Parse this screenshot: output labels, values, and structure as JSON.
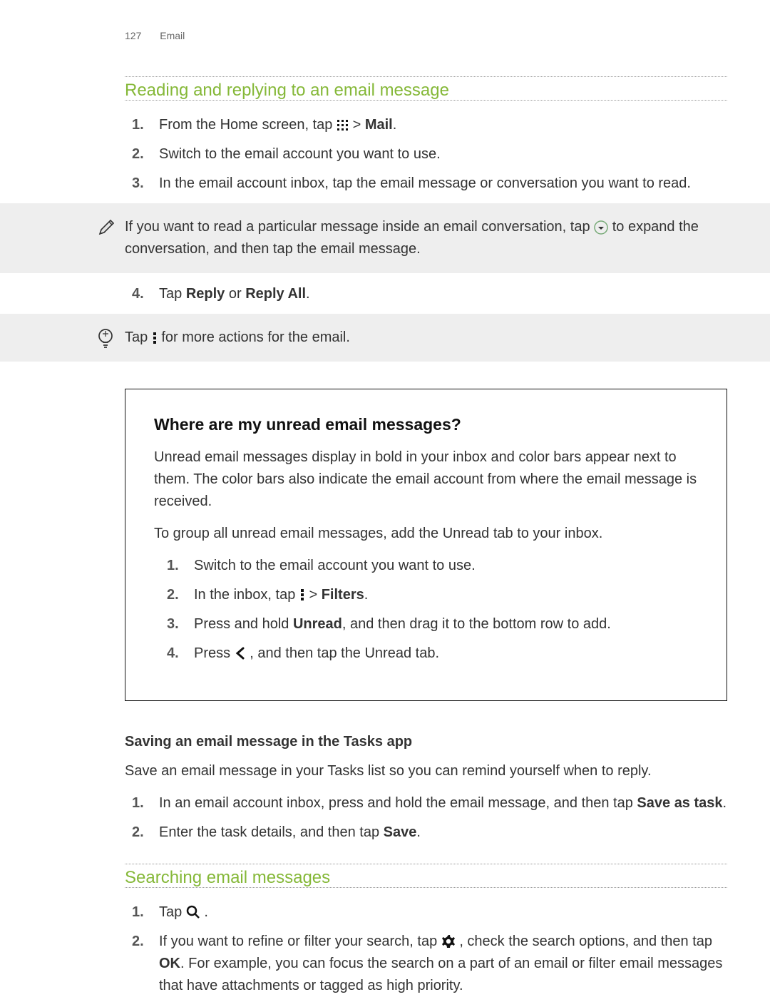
{
  "header": {
    "page_number": "127",
    "section_name": "Email"
  },
  "section1": {
    "title": "Reading and replying to an email message",
    "steps": {
      "1_a": "From the Home screen, tap",
      "1_b": " > ",
      "1_c": "Mail",
      "1_d": ".",
      "2": "Switch to the email account you want to use.",
      "3": "In the email account inbox, tap the email message or conversation you want to read.",
      "4_a": "Tap ",
      "4_b": "Reply",
      "4_c": " or ",
      "4_d": "Reply All",
      "4_e": "."
    },
    "note": {
      "a": "If you want to read a particular message inside an email conversation, tap ",
      "b": " to expand the conversation, and then tap the email message."
    },
    "tip": {
      "a": "Tap ",
      "b": " for more actions for the email."
    }
  },
  "box": {
    "title": "Where are my unread email messages?",
    "p1": "Unread email messages display in bold in your inbox and color bars appear next to them. The color bars also indicate the email account from where the email message is received.",
    "p2": "To group all unread email messages, add the Unread tab to your inbox.",
    "steps": {
      "1": "Switch to the email account you want to use.",
      "2_a": "In the inbox, tap ",
      "2_b": " > ",
      "2_c": "Filters",
      "2_d": ".",
      "3_a": "Press and hold ",
      "3_b": "Unread",
      "3_c": ", and then drag it to the bottom row to add.",
      "4_a": "Press ",
      "4_b": " , and then tap the Unread tab."
    }
  },
  "saving": {
    "heading": "Saving an email message in the Tasks app",
    "intro": "Save an email message in your Tasks list so you can remind yourself when to reply.",
    "steps": {
      "1_a": "In an email account inbox, press and hold the email message, and then tap ",
      "1_b": "Save as task",
      "1_c": ".",
      "2_a": "Enter the task details, and then tap ",
      "2_b": "Save",
      "2_c": "."
    }
  },
  "section2": {
    "title": "Searching email messages",
    "steps": {
      "1_a": "Tap ",
      "1_b": " .",
      "2_a": "If you want to refine or filter your search, tap ",
      "2_b": " , check the search options, and then tap ",
      "2_c": "OK",
      "2_d": ". For example, you can focus the search on a part of an email or filter email messages that have attachments or tagged as high priority."
    }
  }
}
